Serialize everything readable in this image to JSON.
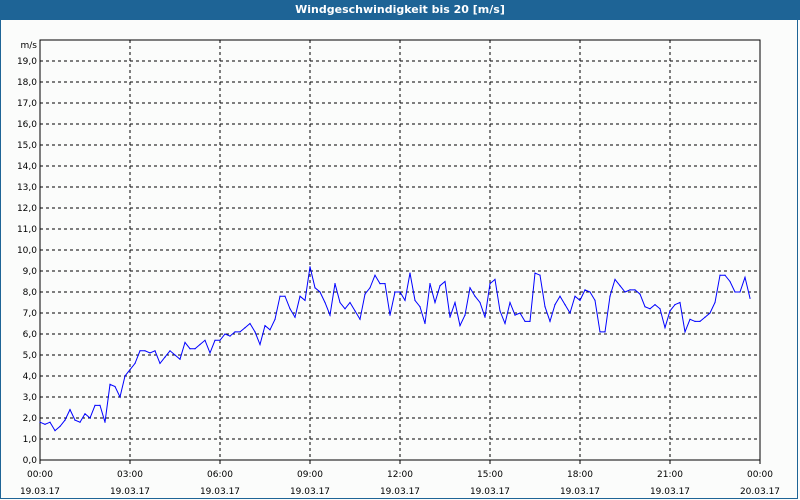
{
  "chart_data": {
    "type": "line",
    "title": "Windgeschwindigkeit bis 20 [m/s]",
    "ylabel": "m/s",
    "xlabel": "",
    "ylim": [
      0,
      20
    ],
    "xlim_minutes": [
      0,
      1440
    ],
    "grid": true,
    "y_ticks": [
      "0,0",
      "1,0",
      "2,0",
      "3,0",
      "4,0",
      "5,0",
      "6,0",
      "7,0",
      "8,0",
      "9,0",
      "10,0",
      "11,0",
      "12,0",
      "13,0",
      "14,0",
      "15,0",
      "16,0",
      "17,0",
      "18,0",
      "19,0"
    ],
    "x_ticks": [
      {
        "time": "00:00",
        "date": "19.03.17"
      },
      {
        "time": "03:00",
        "date": "19.03.17"
      },
      {
        "time": "06:00",
        "date": "19.03.17"
      },
      {
        "time": "09:00",
        "date": "19.03.17"
      },
      {
        "time": "12:00",
        "date": "19.03.17"
      },
      {
        "time": "15:00",
        "date": "19.03.17"
      },
      {
        "time": "18:00",
        "date": "19.03.17"
      },
      {
        "time": "21:00",
        "date": "19.03.17"
      },
      {
        "time": "00:00",
        "date": "20.03.17"
      }
    ],
    "series": [
      {
        "name": "Windgeschwindigkeit",
        "color": "#0000ff",
        "interval_minutes": 10,
        "values": [
          1.8,
          1.7,
          1.8,
          1.4,
          1.6,
          1.9,
          2.4,
          1.9,
          1.8,
          2.2,
          2.0,
          2.6,
          2.6,
          1.8,
          3.6,
          3.5,
          3.0,
          4.0,
          4.3,
          4.6,
          5.2,
          5.2,
          5.1,
          5.2,
          4.6,
          4.9,
          5.2,
          5.0,
          4.8,
          5.6,
          5.3,
          5.3,
          5.5,
          5.7,
          5.1,
          5.7,
          5.7,
          6.0,
          5.9,
          6.1,
          6.1,
          6.3,
          6.5,
          6.1,
          5.5,
          6.4,
          6.2,
          6.7,
          7.8,
          7.8,
          7.2,
          6.8,
          7.8,
          7.6,
          9.2,
          8.2,
          8.0,
          7.5,
          6.9,
          8.4,
          7.5,
          7.2,
          7.5,
          7.1,
          6.7,
          7.9,
          8.2,
          8.8,
          8.4,
          8.4,
          6.9,
          8.0,
          8.0,
          7.6,
          8.9,
          7.6,
          7.3,
          6.5,
          8.4,
          7.5,
          8.3,
          8.5,
          6.8,
          7.5,
          6.4,
          6.9,
          8.2,
          7.8,
          7.5,
          6.8,
          8.4,
          8.6,
          7.1,
          6.5,
          7.5,
          6.9,
          7.0,
          6.6,
          6.6,
          8.9,
          8.8,
          7.3,
          6.6,
          7.4,
          7.8,
          7.4,
          7.0,
          7.8,
          7.6,
          8.1,
          8.0,
          7.6,
          6.1,
          6.1,
          7.8,
          8.6,
          8.3,
          8.0,
          8.1,
          8.1,
          7.9,
          7.3,
          7.2,
          7.4,
          7.2,
          6.3,
          7.1,
          7.4,
          7.5,
          6.1,
          6.7,
          6.6,
          6.6,
          6.8,
          7.0,
          7.5,
          8.8,
          8.8,
          8.5,
          8.0,
          8.0,
          8.7,
          7.7
        ]
      }
    ]
  }
}
